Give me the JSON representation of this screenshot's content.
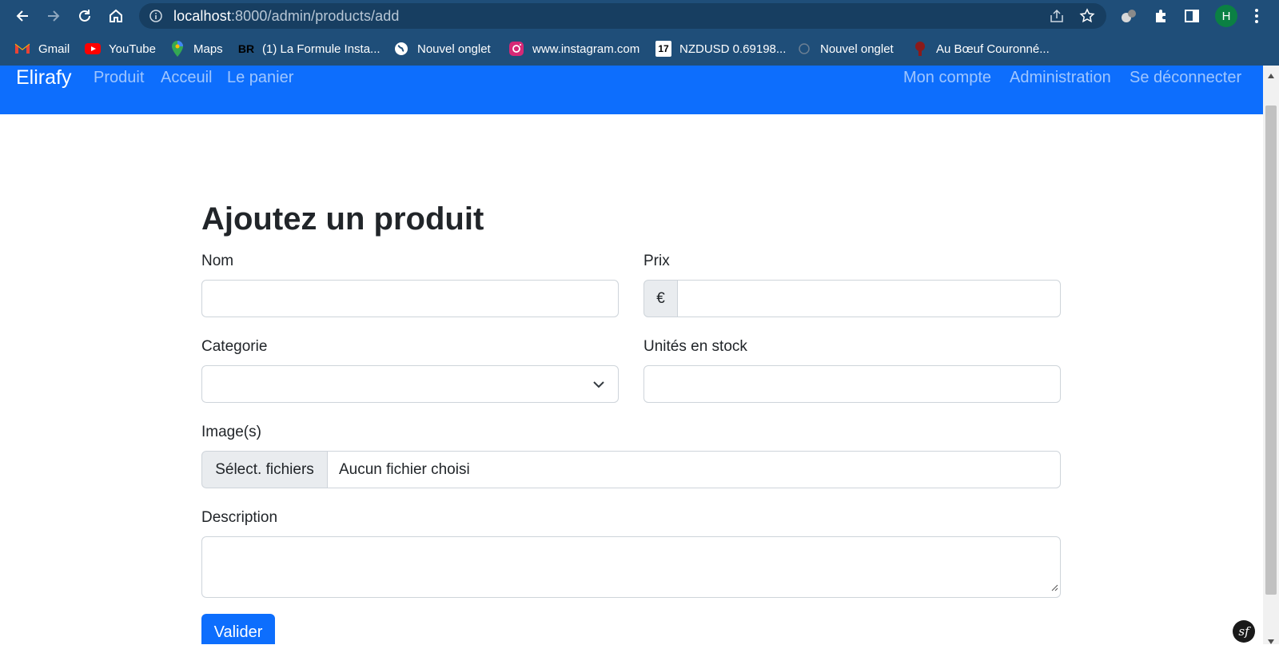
{
  "browser": {
    "url_host": "localhost",
    "url_path": ":8000/admin/products/add",
    "profile_initial": "H",
    "bookmarks": [
      {
        "label": "Gmail",
        "icon": "gmail-icon"
      },
      {
        "label": "YouTube",
        "icon": "youtube-icon"
      },
      {
        "label": "Maps",
        "icon": "maps-icon"
      },
      {
        "label": "(1) La Formule Insta...",
        "icon": "br-icon",
        "icon_text": "BR"
      },
      {
        "label": "Nouvel onglet",
        "icon": "globe-icon"
      },
      {
        "label": "www.instagram.com",
        "icon": "instagram-icon"
      },
      {
        "label": "NZDUSD 0.69198...",
        "icon": "tradingview-icon",
        "icon_text": "17"
      },
      {
        "label": "Nouvel onglet",
        "icon": "nouvel-onglet-icon"
      },
      {
        "label": "Au Bœuf Couronné...",
        "icon": "restaurant-icon"
      }
    ]
  },
  "navbar": {
    "brand": "Elirafy",
    "left_links": [
      "Produit",
      "Acceuil",
      "Le panier"
    ],
    "right_links": [
      "Mon compte",
      "Administration",
      "Se déconnecter"
    ]
  },
  "form": {
    "title": "Ajoutez un produit",
    "name_label": "Nom",
    "price_label": "Prix",
    "price_currency": "€",
    "category_label": "Categorie",
    "stock_label": "Unités en stock",
    "images_label": "Image(s)",
    "file_button": "Sélect. fichiers",
    "file_status": "Aucun fichier choisi",
    "description_label": "Description",
    "submit": "Valider"
  },
  "symfony_badge": "sf",
  "colors": {
    "chrome": "#1f4e79",
    "navbar": "#0d6efd",
    "primary": "#0d6efd"
  }
}
